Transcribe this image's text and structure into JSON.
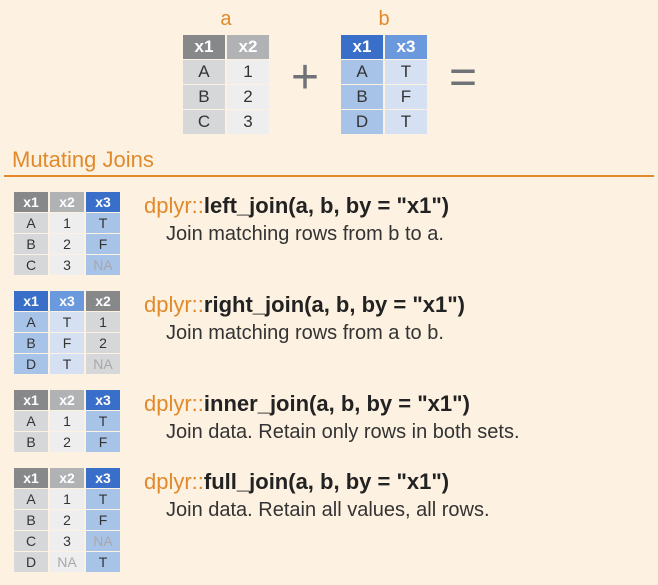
{
  "top": {
    "a": {
      "label": "a",
      "headers": [
        "x1",
        "x2"
      ],
      "rows": [
        [
          "A",
          "1"
        ],
        [
          "B",
          "2"
        ],
        [
          "C",
          "3"
        ]
      ]
    },
    "plus": "+",
    "b": {
      "label": "b",
      "headers": [
        "x1",
        "x3"
      ],
      "rows": [
        [
          "A",
          "T"
        ],
        [
          "B",
          "F"
        ],
        [
          "D",
          "T"
        ]
      ]
    },
    "equals": "="
  },
  "section_title": "Mutating Joins",
  "joins": [
    {
      "result": {
        "headers": [
          "x1",
          "x2",
          "x3"
        ],
        "rows": [
          [
            "A",
            "1",
            "T"
          ],
          [
            "B",
            "2",
            "F"
          ],
          [
            "C",
            "3",
            "NA"
          ]
        ]
      },
      "prefix": "dplyr::",
      "fn": "left_join",
      "args": "(a, b, by = \"x1\")",
      "desc": "Join matching rows from b to a."
    },
    {
      "result": {
        "headers": [
          "x1",
          "x3",
          "x2"
        ],
        "rows": [
          [
            "A",
            "T",
            "1"
          ],
          [
            "B",
            "F",
            "2"
          ],
          [
            "D",
            "T",
            "NA"
          ]
        ]
      },
      "prefix": "dplyr::",
      "fn": "right_join",
      "args": "(a, b, by = \"x1\")",
      "desc": "Join matching rows from a to b."
    },
    {
      "result": {
        "headers": [
          "x1",
          "x2",
          "x3"
        ],
        "rows": [
          [
            "A",
            "1",
            "T"
          ],
          [
            "B",
            "2",
            "F"
          ]
        ]
      },
      "prefix": "dplyr::",
      "fn": "inner_join",
      "args": "(a, b, by = \"x1\")",
      "desc": "Join data. Retain only rows in both sets."
    },
    {
      "result": {
        "headers": [
          "x1",
          "x2",
          "x3"
        ],
        "rows": [
          [
            "A",
            "1",
            "T"
          ],
          [
            "B",
            "2",
            "F"
          ],
          [
            "C",
            "3",
            "NA"
          ],
          [
            "D",
            "NA",
            "T"
          ]
        ]
      },
      "prefix": "dplyr::",
      "fn": "full_join",
      "args": "(a, b, by = \"x1\")",
      "desc": "Join data. Retain all values, all rows."
    }
  ]
}
